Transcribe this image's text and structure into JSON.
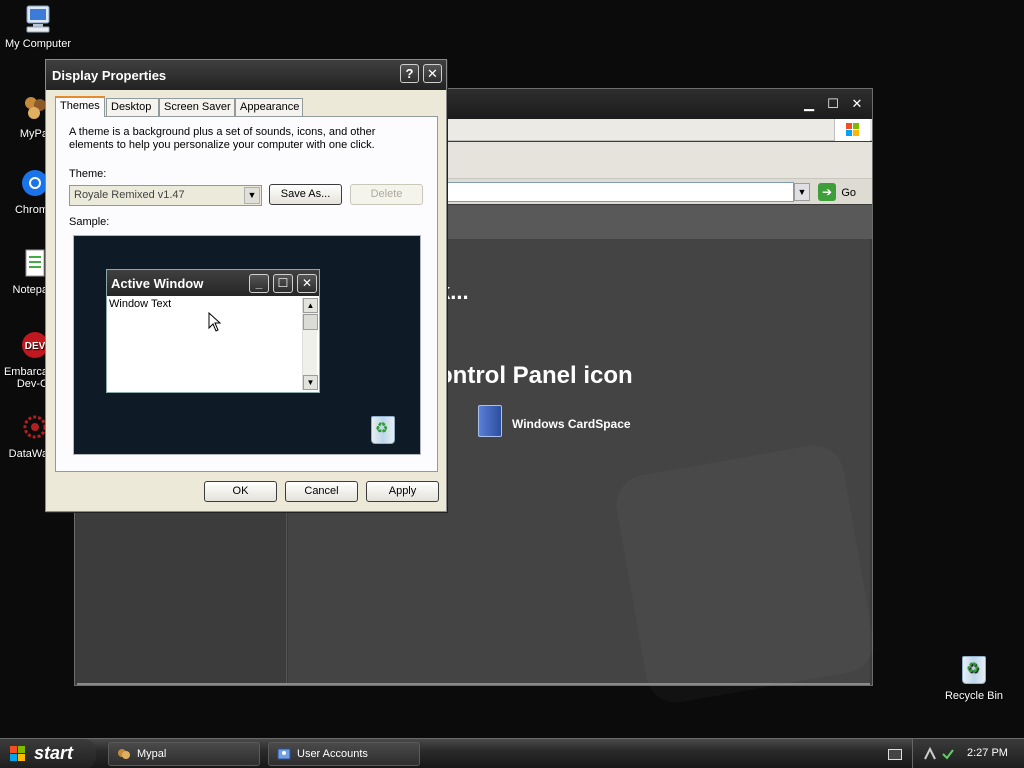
{
  "desktop": {
    "icons": [
      {
        "label": "My Computer"
      },
      {
        "label": "MyPa"
      },
      {
        "label": "Chrom"
      },
      {
        "label": "Notepa"
      },
      {
        "label": "Embarca",
        "label2": "Dev-C"
      },
      {
        "label": "DataWa"
      }
    ],
    "recycle_bin": {
      "label": "Recycle Bin"
    }
  },
  "explorer": {
    "address_go": "Go",
    "pick_heading": "k...",
    "pick_sub": "t",
    "cp_heading": "ontrol Panel icon",
    "cardspace_label": "Windows CardSpace"
  },
  "dialog": {
    "title": "Display Properties",
    "help_glyph": "?",
    "close_glyph": "✕",
    "tabs": [
      {
        "label": "Themes",
        "active": true
      },
      {
        "label": "Desktop",
        "active": false
      },
      {
        "label": "Screen Saver",
        "active": false
      },
      {
        "label": "Appearance",
        "active": false
      }
    ],
    "description": "A theme is a background plus a set of sounds, icons, and other elements to help you personalize your computer with one click.",
    "theme_label": "Theme:",
    "theme_value": "Royale Remixed v1.47",
    "save_as": "Save As...",
    "delete": "Delete",
    "sample_label": "Sample:",
    "preview": {
      "window_title": "Active Window",
      "window_text": "Window Text"
    },
    "ok": "OK",
    "cancel": "Cancel",
    "apply": "Apply"
  },
  "taskbar": {
    "start": "start",
    "tasks": [
      {
        "label": "Mypal"
      },
      {
        "label": "User Accounts"
      }
    ],
    "clock": "2:27 PM"
  }
}
